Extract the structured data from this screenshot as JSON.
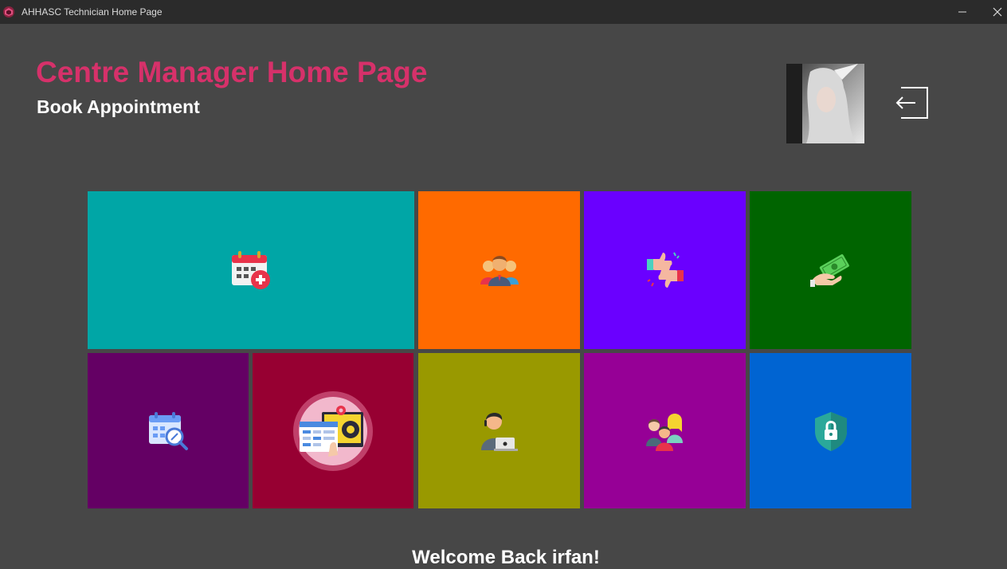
{
  "window": {
    "title": "AHHASC Technician Home Page",
    "controls": [
      "minimize-icon",
      "close-icon"
    ]
  },
  "header": {
    "title": "Centre Manager Home Page",
    "subtitle": "Book Appointment",
    "title_color": "#d6316a"
  },
  "tiles": [
    {
      "icon": "calendar-add-icon",
      "color": "#00a6a6"
    },
    {
      "icon": "customers-group-icon",
      "color": "#ff6a00"
    },
    {
      "icon": "feedback-thumbs-icon",
      "color": "#6a00ff"
    },
    {
      "icon": "payment-cash-icon",
      "color": "#006400"
    },
    {
      "icon": "calendar-search-icon",
      "color": "#640064"
    },
    {
      "icon": "system-settings-icon",
      "color": "#970032"
    },
    {
      "icon": "technician-laptop-icon",
      "color": "#999900"
    },
    {
      "icon": "staff-team-icon",
      "color": "#960096"
    },
    {
      "icon": "security-shield-icon",
      "color": "#0064d2"
    }
  ],
  "footer": {
    "welcome": "Welcome Back irfan!"
  },
  "colors": {
    "background": "#474747",
    "titlebar": "#2b2b2b"
  }
}
